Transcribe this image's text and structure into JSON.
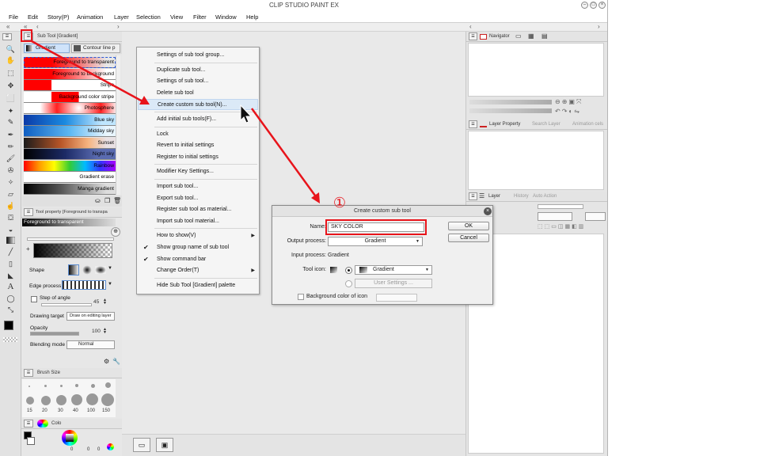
{
  "app": {
    "title": "CLIP STUDIO PAINT EX"
  },
  "menu": [
    "File",
    "Edit",
    "Story(P)",
    "Animation",
    "Layer",
    "Selection",
    "View",
    "Filter",
    "Window",
    "Help"
  ],
  "subtool_palette": {
    "tab_title": "Sub Tool [Gradient]",
    "groups": [
      "Gradient",
      "Contour line p"
    ],
    "gradients": [
      {
        "label": "Foreground to transparent",
        "bg": "linear-gradient(90deg,#ff0000 30%,rgba(255,0,0,0) 90%)",
        "selected": true
      },
      {
        "label": "Foreground to background",
        "bg": "linear-gradient(90deg,#ff0000 30%,#ffffff 90%)"
      },
      {
        "label": "Stripe",
        "bg": "linear-gradient(90deg,#ff0000 0 30%,#ffffff 30% 100%)"
      },
      {
        "label": "Background color stripe",
        "bg": "linear-gradient(90deg,#fff 0 30%,#ff0000 30% 60%,#fff 60%)"
      },
      {
        "label": "Photosphere",
        "bg": "radial-gradient(circle at 60% 50%,#ffffff 0,#ff2020 40%,#fff 70%)"
      },
      {
        "label": "Blue sky",
        "bg": "linear-gradient(90deg,#0b3aa8,#1a8ae0 45%,#bfe6ff 85%)"
      },
      {
        "label": "Midday sky",
        "bg": "linear-gradient(90deg,#0f5ec2,#5db8f2 50%,#e9f6ff 90%)"
      },
      {
        "label": "Sunset",
        "bg": "linear-gradient(90deg,#1b1b1b,#b75527 40%,#f6b37f 70%,#e9e1e4 90%)"
      },
      {
        "label": "Night sky",
        "bg": "linear-gradient(90deg,#000,#1c2a66 45%,#5a6bb0 80%)"
      },
      {
        "label": "Rainbow",
        "bg": "linear-gradient(90deg,#ff0000,#ff9900,#ffff00,#33cc33,#00bbff,#3333ff,#aa00ff)"
      },
      {
        "label": "Gradient erase",
        "bg": "#ffffff"
      },
      {
        "label": "Manga gradient",
        "bg": "linear-gradient(90deg,#000,#555 40%,#ddd 90%)"
      }
    ]
  },
  "tool_property": {
    "tab_title": "Tool property [Foreground to transpa",
    "preview_label": "Foreground to transparent",
    "shape_label": "Shape",
    "edge_label": "Edge process",
    "step_label": "Step of angle",
    "step_value": "45",
    "target_label": "Drawing target",
    "target_value": "Draw on editing layer",
    "opacity_label": "Opacity",
    "opacity_value": "100",
    "blend_label": "Blending mode",
    "blend_value": "Normal"
  },
  "brush_size": {
    "tab_title": "Brush Size",
    "sizes": [
      "15",
      "20",
      "30",
      "40",
      "100",
      "150"
    ]
  },
  "color_panel": {
    "tab_label": "Colo",
    "values": [
      "0",
      "0",
      "0"
    ]
  },
  "right_panel": {
    "navigator_tab": "Navigator",
    "layer_property_tab": "Layer Property",
    "search_layer_tab": "Search Layer",
    "animation_cels_tab": "Animation cels",
    "layer_tab": "Layer",
    "history_tab": "History",
    "auto_action_tab": "Auto Action"
  },
  "context_menu": {
    "items": [
      {
        "label": "Settings of sub tool group..."
      },
      {
        "sep": true
      },
      {
        "label": "Duplicate sub tool..."
      },
      {
        "label": "Settings of sub tool..."
      },
      {
        "label": "Delete sub tool"
      },
      {
        "label": "Create custom sub tool(N)...",
        "highlight": true
      },
      {
        "sep": true
      },
      {
        "label": "Add initial sub tools(F)..."
      },
      {
        "sep": true
      },
      {
        "label": "Lock"
      },
      {
        "label": "Revert to initial settings"
      },
      {
        "label": "Register to initial settings"
      },
      {
        "sep": true
      },
      {
        "label": "Modifier Key Settings..."
      },
      {
        "sep": true
      },
      {
        "label": "Import sub tool..."
      },
      {
        "label": "Export sub tool..."
      },
      {
        "label": "Register sub tool as material..."
      },
      {
        "label": "Import sub tool material..."
      },
      {
        "sep": true
      },
      {
        "label": "How to show(V)",
        "submenu": true
      },
      {
        "label": "Show group name of sub tool",
        "checked": true
      },
      {
        "label": "Show command bar",
        "checked": true
      },
      {
        "label": "Change Order(T)",
        "submenu": true
      },
      {
        "sep": true
      },
      {
        "label": "Hide Sub Tool [Gradient] palette"
      }
    ]
  },
  "dialog": {
    "title": "Create custom sub tool",
    "name_label": "Name:",
    "name_value": "SKY COLOR",
    "ok_label": "OK",
    "cancel_label": "Cancel",
    "output_label": "Output process:",
    "output_value": "Gradient",
    "input_label": "Input process:",
    "input_value": "Gradient",
    "icon_label": "Tool icon:",
    "icon_value": "Gradient",
    "user_settings_label": "User Settings ...",
    "bg_color_label": "Background color of icon"
  },
  "annotation": {
    "step_marker": "①",
    "color": "#e8141b"
  }
}
